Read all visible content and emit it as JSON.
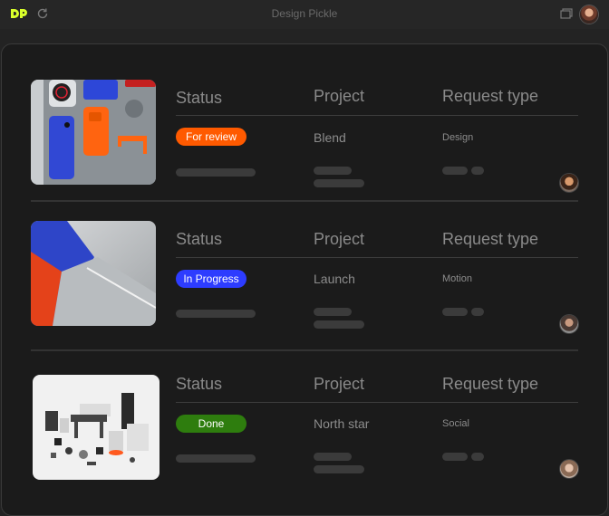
{
  "window": {
    "title": "Design Pickle"
  },
  "icons": {
    "logo": "design-pickle-logo",
    "refresh": "refresh-icon",
    "tab": "tab-switcher-icon",
    "avatar": "user-avatar"
  },
  "colors": {
    "logo": "#d9ff2b",
    "for_review": "#ff5a00",
    "in_progress": "#2d3cff",
    "done": "#2e7d0e"
  },
  "requests": [
    {
      "headers": {
        "status": "Status",
        "project": "Project",
        "type": "Request type"
      },
      "status": "For review",
      "project": "Blend",
      "request_type": "Design"
    },
    {
      "headers": {
        "status": "Status",
        "project": "Project",
        "type": "Request type"
      },
      "status": "In Progress",
      "project": "Launch",
      "request_type": "Motion"
    },
    {
      "headers": {
        "status": "Status",
        "project": "Project",
        "type": "Request type"
      },
      "status": "Done",
      "project": "North star",
      "request_type": "Social"
    }
  ]
}
